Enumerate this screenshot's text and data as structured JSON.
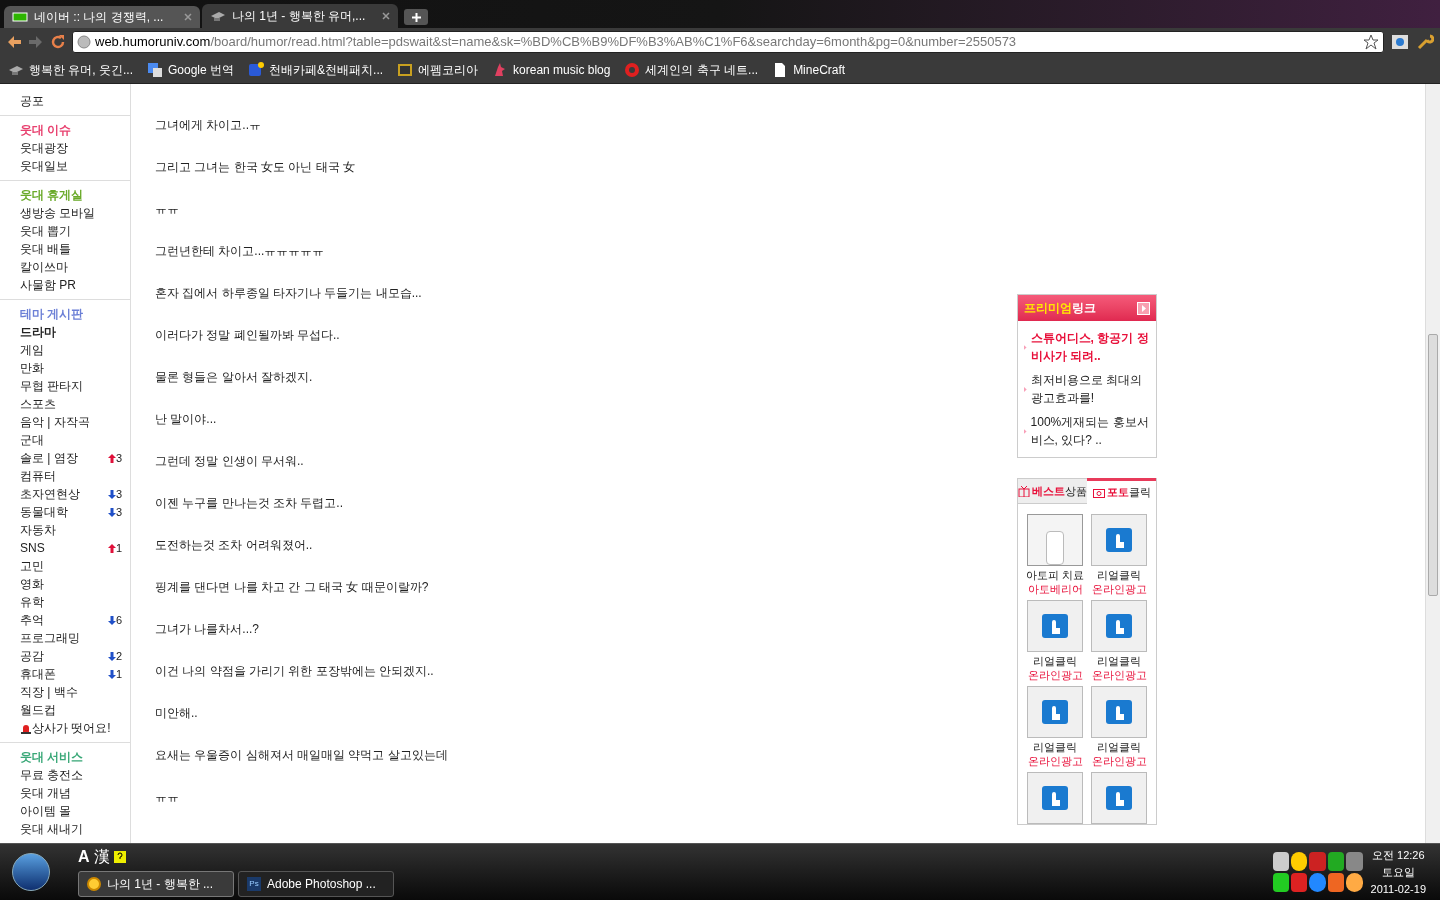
{
  "browser": {
    "tabs": [
      {
        "title": "네이버 :: 나의 경쟁력, ...",
        "selected": false,
        "kind": "naver"
      },
      {
        "title": "나의 1년 - 행복한 유머,...",
        "selected": true,
        "kind": "hat"
      }
    ],
    "url": {
      "host": "web.humoruniv.com",
      "path": "/board/humor/read.html?table=pdswait&st=name&sk=%BD%CB%B9%DF%B3%AB%C1%F6&searchday=6month&pg=0&number=2550573"
    },
    "bookmarks": [
      {
        "label": "행복한 유머, 웃긴...",
        "kind": "hat"
      },
      {
        "label": "Google 번역",
        "kind": "translate"
      },
      {
        "label": "천배카페&천배패치...",
        "kind": "d"
      },
      {
        "label": "에펨코리아",
        "kind": "ten"
      },
      {
        "label": "korean music blog",
        "kind": "unicorn"
      },
      {
        "label": "세계인의 축구 네트...",
        "kind": "g"
      },
      {
        "label": "MineCraft",
        "kind": "page"
      }
    ]
  },
  "sidebar": [
    {
      "items": [
        {
          "label": "공포"
        }
      ]
    },
    {
      "title": "웃대 이슈",
      "color": "#e8416f",
      "items": [
        {
          "label": "웃대광장"
        },
        {
          "label": "웃대일보"
        }
      ]
    },
    {
      "title": "웃대 휴게실",
      "color": "#6aaa2a",
      "items": [
        {
          "label": "생방송 모바일"
        },
        {
          "label": "웃대 뽑기"
        },
        {
          "label": "웃대 배틀"
        },
        {
          "label": "칼이쓰마"
        },
        {
          "label": "사물함 PR"
        }
      ]
    },
    {
      "title": "테마 게시판",
      "color": "#6b7fd6",
      "items": [
        {
          "label": "드라마",
          "bold": true
        },
        {
          "label": "게임"
        },
        {
          "label": "만화"
        },
        {
          "label": "무협 판타지"
        },
        {
          "label": "스포츠"
        },
        {
          "label": "음악 | 자작곡"
        },
        {
          "label": "군대"
        },
        {
          "label": "솔로 | 염장",
          "rising": true,
          "count": "3"
        },
        {
          "label": "컴퓨터"
        },
        {
          "label": "초자연현상",
          "rising": false,
          "count": "3"
        },
        {
          "label": "동물대학",
          "rising": false,
          "count": "3"
        },
        {
          "label": "자동차"
        },
        {
          "label": "SNS",
          "rising": true,
          "count": "1"
        },
        {
          "label": "고민"
        },
        {
          "label": "영화"
        },
        {
          "label": "유학"
        },
        {
          "label": "추억",
          "rising": false,
          "count": "6"
        },
        {
          "label": "프로그래밍"
        },
        {
          "label": "공감",
          "rising": false,
          "count": "2"
        },
        {
          "label": "휴대폰",
          "rising": false,
          "count": "1"
        },
        {
          "label": "직장 | 백수"
        },
        {
          "label": "월드컵"
        },
        {
          "label": "상사가 떳어요!",
          "kind": "alert"
        }
      ]
    },
    {
      "title": "웃대 서비스",
      "color": "#3aa878",
      "items": [
        {
          "label": "무료 충전소"
        },
        {
          "label": "웃대 개념"
        },
        {
          "label": "아이템 몰"
        },
        {
          "label": "웃대 새내기"
        }
      ]
    }
  ],
  "article": [
    "그녀에게 차이고..ㅠ",
    "그리고 그녀는 한국 女도 아닌 태국 女",
    "ㅠㅠ",
    "그런년한테 차이고...ㅠㅠㅠㅠㅠ",
    "혼자 집에서 하루종일 타자기나 두들기는 내모습...",
    "이러다가 정말 폐인될까봐 무섭다..",
    "물론 형들은 알아서 잘하겠지.",
    "난 말이야...",
    "그런데 정말 인생이 무서워..",
    "이젠 누구를 만나는것 조차 두렵고..",
    "도전하는것 조차 어려워졌어..",
    "핑계를 댄다면 나를 차고 간 그 태국 女 때문이랄까?",
    "그녀가 나를차서...?",
    "이건 나의 약점을 가리기 위한 포장밖에는 안되겠지..",
    "미안해..",
    "요새는 우울증이 심해져서 매일매일 약먹고 살고있는데",
    "ㅠㅠ"
  ],
  "premium": {
    "title_highlight": "프리미엄",
    "title_rest": "링크",
    "links": [
      {
        "text": "스튜어디스, 항공기 정비사가 되려..",
        "featured": true
      },
      {
        "text": "최저비용으로 최대의 광고효과를!",
        "featured": false
      },
      {
        "text": "100%게재되는 홍보서비스, 있다? ..",
        "featured": false
      }
    ]
  },
  "products": {
    "tabs": [
      {
        "highlight": "베스트",
        "rest": "상품",
        "selected": false,
        "kind": "gift"
      },
      {
        "highlight": "포토",
        "rest": "클릭",
        "selected": true,
        "kind": "camera"
      }
    ],
    "items": [
      {
        "name": "아토피 치료",
        "sub": "아토베리어",
        "kind": "bottle"
      },
      {
        "name": "리얼클릭",
        "sub": "온라인광고",
        "kind": "realclick"
      },
      {
        "name": "리얼클릭",
        "sub": "온라인광고",
        "kind": "realclick"
      },
      {
        "name": "리얼클릭",
        "sub": "온라인광고",
        "kind": "realclick"
      },
      {
        "name": "리얼클릭",
        "sub": "온라인광고",
        "kind": "realclick"
      },
      {
        "name": "리얼클릭",
        "sub": "온라인광고",
        "kind": "realclick"
      },
      {
        "kind": "realclick"
      },
      {
        "kind": "realclick"
      }
    ]
  },
  "taskbar": {
    "language": "A",
    "ime": "漢",
    "tasks": [
      {
        "label": "나의 1년 - 행복한 ...",
        "kind": "chrome",
        "selected": true
      },
      {
        "label": "Adobe Photoshop ...",
        "kind": "ps",
        "icon_text": "Ps",
        "selected": false
      }
    ],
    "time": "오전 12:26",
    "day": "토요일",
    "date": "2011-02-19"
  }
}
